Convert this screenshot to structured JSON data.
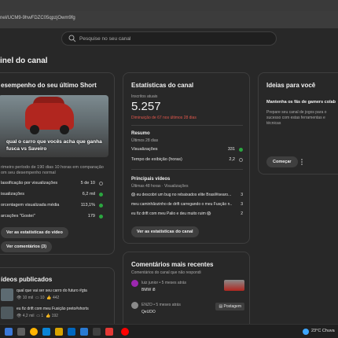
{
  "browser": {
    "url": "nel/UCM9-9hwFDZC05qpzjOwm9fg"
  },
  "search": {
    "placeholder": "Pesquise no seu canal"
  },
  "page": {
    "title": "inel do canal"
  },
  "short_card": {
    "title": "esempenho do seu último Short",
    "thumbnail_caption": "qual o carro que vocês acha que ganha fusca vs Saveiro",
    "description": "rimeiro período de 190 dias 10 horas em comparação om seu desempenho normal",
    "metrics": [
      {
        "label": "lassificação por visualizações",
        "value": "5 de 10",
        "indicator": "gray"
      },
      {
        "label": "isualizações",
        "value": "6,2 mil",
        "indicator": "green"
      },
      {
        "label": "orcentagem visualizada média",
        "value": "113,1%",
        "indicator": "green"
      },
      {
        "label": "arcações \"Gostei\"",
        "value": "179",
        "indicator": "green"
      }
    ],
    "btn_stats": "Ver as estatísticas do vídeo",
    "btn_comments": "Ver comentários (3)"
  },
  "stats_card": {
    "title": "Estatísticas do canal",
    "subs_label": "Inscritos atuais",
    "subs_value": "5.257",
    "subs_change": "Diminuição de 67 nos últimos 28 dias",
    "summary_title": "Resumo",
    "summary_period": "Últimos 28 dias",
    "summary_rows": [
      {
        "label": "Visualizações",
        "value": "331"
      },
      {
        "label": "Tempo de exibição (horas)",
        "value": "2,2"
      }
    ],
    "videos_title": "Principais vídeos",
    "videos_period": "Últimas 48 horas · Visualizações",
    "videos": [
      {
        "title": "😱 eu descobri um bug no rebaixados elite Brasil#searo...",
        "value": "3"
      },
      {
        "title": "meu caminhãozinho de drift carregando o meu Fusção n...",
        "value": "3"
      },
      {
        "title": "eu fiz drift com meu Palio e deu muito ruim 😱",
        "value": "2"
      }
    ],
    "btn": "Ver as estatísticas do canal"
  },
  "ideas_card": {
    "title": "Ideias para você",
    "subtitle": "Mantenha os fãs de gamers colab",
    "description": "Prepare seu canal de jogos para o sucesso com estas ferramentas e técnicas",
    "btn": "Começar"
  },
  "published_card": {
    "title": "ídeos publicados",
    "videos": [
      {
        "title": "qual que vai ser seu carro do futuro #gta",
        "views": "10 mil",
        "comments": "10",
        "likes": "442"
      },
      {
        "title": "eu fiz drift com meu Fusição preto#shorts",
        "views": "4,2 mil",
        "comments": "1",
        "likes": "192"
      }
    ]
  },
  "comments_card": {
    "title": "Comentários mais recentes",
    "subtitle": "Comentários do canal que não respondi",
    "comments": [
      {
        "author": "luiz junior • 5 meses atrás",
        "text": "BMW i8",
        "avatar_color": "#9c27b0"
      },
      {
        "author": "ENZO • 5 meses atrás",
        "text": "QeUDO",
        "avatar_color": "#8a8a8a",
        "tag": "Postagem"
      }
    ]
  },
  "taskbar": {
    "weather": "23°C  Chuva"
  },
  "colors": {
    "accent_red": "#e2574c",
    "success_green": "#2ba640",
    "panel": "#282828"
  }
}
